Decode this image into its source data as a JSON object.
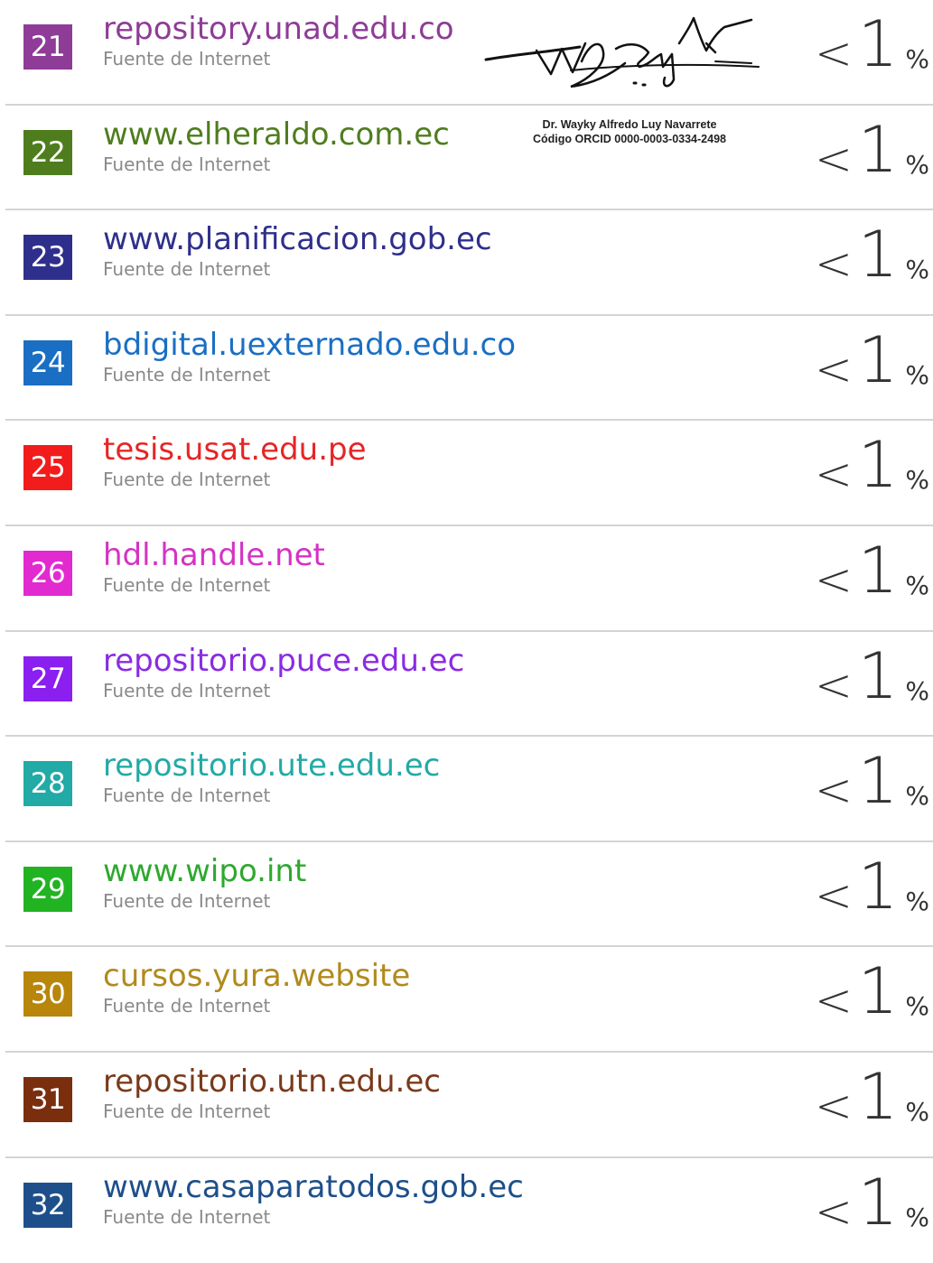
{
  "sources": [
    {
      "number": "21",
      "name": "repository.unad.edu.co",
      "type": "Fuente de Internet",
      "percent_prefix": "<",
      "percent_value": "1",
      "percent_sign": "%",
      "color": "#8e3c97",
      "badge_color": "#8e3c97"
    },
    {
      "number": "22",
      "name": "www.elheraldo.com.ec",
      "type": "Fuente de Internet",
      "percent_prefix": "<",
      "percent_value": "1",
      "percent_sign": "%",
      "color": "#4f7d1e",
      "badge_color": "#4f7d1e"
    },
    {
      "number": "23",
      "name": "www.planificacion.gob.ec",
      "type": "Fuente de Internet",
      "percent_prefix": "<",
      "percent_value": "1",
      "percent_sign": "%",
      "color": "#2e2f8c",
      "badge_color": "#2e2f8c"
    },
    {
      "number": "24",
      "name": "bdigital.uexternado.edu.co",
      "type": "Fuente de Internet",
      "percent_prefix": "<",
      "percent_value": "1",
      "percent_sign": "%",
      "color": "#1a6fc4",
      "badge_color": "#1a6fc4"
    },
    {
      "number": "25",
      "name": "tesis.usat.edu.pe",
      "type": "Fuente de Internet",
      "percent_prefix": "<",
      "percent_value": "1",
      "percent_sign": "%",
      "color": "#e52525",
      "badge_color": "#f21c1c"
    },
    {
      "number": "26",
      "name": "hdl.handle.net",
      "type": "Fuente de Internet",
      "percent_prefix": "<",
      "percent_value": "1",
      "percent_sign": "%",
      "color": "#d433c4",
      "badge_color": "#e12ad0"
    },
    {
      "number": "27",
      "name": "repositorio.puce.edu.ec",
      "type": "Fuente de Internet",
      "percent_prefix": "<",
      "percent_value": "1",
      "percent_sign": "%",
      "color": "#8a2be2",
      "badge_color": "#8a1ff0"
    },
    {
      "number": "28",
      "name": "repositorio.ute.edu.ec",
      "type": "Fuente de Internet",
      "percent_prefix": "<",
      "percent_value": "1",
      "percent_sign": "%",
      "color": "#22aaa6",
      "badge_color": "#21aaa6"
    },
    {
      "number": "29",
      "name": "www.wipo.int",
      "type": "Fuente de Internet",
      "percent_prefix": "<",
      "percent_value": "1",
      "percent_sign": "%",
      "color": "#2ea82e",
      "badge_color": "#22b322"
    },
    {
      "number": "30",
      "name": "cursos.yura.website",
      "type": "Fuente de Internet",
      "percent_prefix": "<",
      "percent_value": "1",
      "percent_sign": "%",
      "color": "#b08a1c",
      "badge_color": "#b8860b"
    },
    {
      "number": "31",
      "name": "repositorio.utn.edu.ec",
      "type": "Fuente de Internet",
      "percent_prefix": "<",
      "percent_value": "1",
      "percent_sign": "%",
      "color": "#7a3a1a",
      "badge_color": "#7a2e0e"
    },
    {
      "number": "32",
      "name": "www.casaparatodos.gob.ec",
      "type": "Fuente de Internet",
      "percent_prefix": "<",
      "percent_value": "1",
      "percent_sign": "%",
      "color": "#1e4f8a",
      "badge_color": "#1e4f8a"
    }
  ],
  "signature_caption": {
    "line1": "Dr. Wayky Alfredo Luy Navarrete",
    "line2": "Código ORCID 0000-0003-0334-2498"
  }
}
